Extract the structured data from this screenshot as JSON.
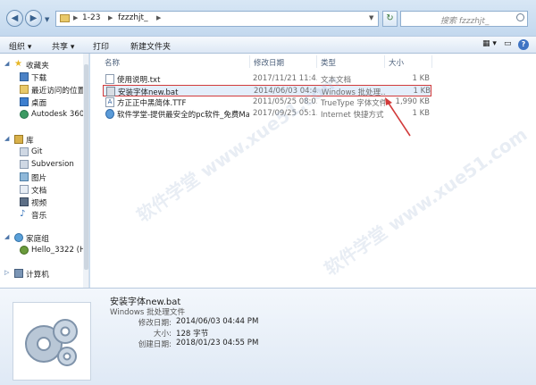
{
  "address": {
    "crumbs": [
      "1-23",
      "fzzzhjt_"
    ]
  },
  "search": {
    "placeholder": "搜索 fzzzhjt_"
  },
  "toolbar": {
    "organize": "组织 ▾",
    "share": "共享 ▾",
    "print": "打印",
    "new_folder": "新建文件夹"
  },
  "sidebar": {
    "favorites": "收藏夹",
    "fav_items": [
      "下载",
      "最近访问的位置",
      "桌面",
      "Autodesk 360"
    ],
    "libraries": "库",
    "lib_items": [
      "Git",
      "Subversion",
      "图片",
      "文档",
      "视频",
      "音乐"
    ],
    "homegroup": "家庭组",
    "home_items": [
      "Hello_3322 (HEL"
    ],
    "computer": "计算机"
  },
  "columns": {
    "name": "名称",
    "modified": "修改日期",
    "type": "类型",
    "size": "大小"
  },
  "files": [
    {
      "name": "使用说明.txt",
      "modified": "2017/11/21 11:4...",
      "type": "文本文档",
      "size": "1 KB",
      "icon": "text-file-icon"
    },
    {
      "name": "安装字体new.bat",
      "modified": "2014/06/03 04:4...",
      "type": "Windows 批处理...",
      "size": "1 KB",
      "icon": "batch-file-icon"
    },
    {
      "name": "方正正中黑简体.TTF",
      "modified": "2011/05/25 08:0...",
      "type": "TrueType 字体文件",
      "size": "1,990 KB",
      "icon": "font-file-icon"
    },
    {
      "name": "软件学堂-提供最安全的pc软件_免费Ma...",
      "modified": "2017/09/25 05:1...",
      "type": "Internet 快捷方式",
      "size": "1 KB",
      "icon": "internet-shortcut-icon"
    }
  ],
  "details": {
    "filename": "安装字体new.bat",
    "filetype": "Windows 批处理文件",
    "modified_label": "修改日期:",
    "modified_value": "2014/06/03 04:44 PM",
    "size_label": "大小:",
    "size_value": "128 字节",
    "created_label": "创建日期:",
    "created_value": "2018/01/23 04:55 PM"
  },
  "watermark": "软件学堂 www.xue51.com",
  "colors": {
    "selection_border": "#d23b3b",
    "selection_fill": "#e4eefb",
    "chrome": "#c9dcef"
  }
}
